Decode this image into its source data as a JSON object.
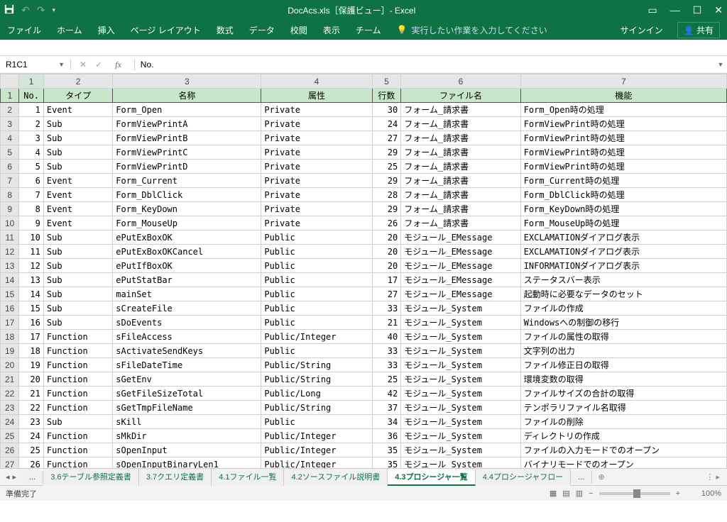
{
  "title": "DocAcs.xls［保護ビュー］- Excel",
  "qat": {
    "undo": "↶",
    "redo": "↷",
    "dd": "▾"
  },
  "ribbon": {
    "tabs": [
      "ファイル",
      "ホーム",
      "挿入",
      "ページ レイアウト",
      "数式",
      "データ",
      "校閲",
      "表示",
      "チーム"
    ],
    "tell_placeholder": "実行したい作業を入力してください",
    "signin": "サインイン",
    "share": "共有"
  },
  "namebox": "R1C1",
  "fx": "No.",
  "col_heads": [
    "",
    "1",
    "2",
    "3",
    "4",
    "5",
    "6",
    "7"
  ],
  "header_row": [
    "No.",
    "タイプ",
    "名称",
    "属性",
    "行数",
    "ファイル名",
    "機能"
  ],
  "rows": [
    {
      "n": "1",
      "no": "1",
      "type": "Event",
      "name": "Form_Open",
      "attr": "Private",
      "lines": "30",
      "file": "フォーム_請求書",
      "func": "Form_Open時の処理"
    },
    {
      "n": "2",
      "no": "2",
      "type": "Sub",
      "name": "FormViewPrintA",
      "attr": "Private",
      "lines": "24",
      "file": "フォーム_請求書",
      "func": "FormViewPrint時の処理"
    },
    {
      "n": "3",
      "no": "3",
      "type": "Sub",
      "name": "FormViewPrintB",
      "attr": "Private",
      "lines": "27",
      "file": "フォーム_請求書",
      "func": "FormViewPrint時の処理"
    },
    {
      "n": "4",
      "no": "4",
      "type": "Sub",
      "name": "FormViewPrintC",
      "attr": "Private",
      "lines": "29",
      "file": "フォーム_請求書",
      "func": "FormViewPrint時の処理"
    },
    {
      "n": "5",
      "no": "5",
      "type": "Sub",
      "name": "FormViewPrintD",
      "attr": "Private",
      "lines": "25",
      "file": "フォーム_請求書",
      "func": "FormViewPrint時の処理"
    },
    {
      "n": "6",
      "no": "6",
      "type": "Event",
      "name": "Form_Current",
      "attr": "Private",
      "lines": "29",
      "file": "フォーム_請求書",
      "func": "Form_Current時の処理"
    },
    {
      "n": "7",
      "no": "7",
      "type": "Event",
      "name": "Form_DblClick",
      "attr": "Private",
      "lines": "28",
      "file": "フォーム_請求書",
      "func": "Form_DblClick時の処理"
    },
    {
      "n": "8",
      "no": "8",
      "type": "Event",
      "name": "Form_KeyDown",
      "attr": "Private",
      "lines": "29",
      "file": "フォーム_請求書",
      "func": "Form_KeyDown時の処理"
    },
    {
      "n": "9",
      "no": "9",
      "type": "Event",
      "name": "Form_MouseUp",
      "attr": "Private",
      "lines": "26",
      "file": "フォーム_請求書",
      "func": "Form_MouseUp時の処理"
    },
    {
      "n": "10",
      "no": "10",
      "type": "Sub",
      "name": "ePutExBoxOK",
      "attr": "Public",
      "lines": "20",
      "file": "モジュール_EMessage",
      "func": "EXCLAMATIONダイアログ表示"
    },
    {
      "n": "11",
      "no": "11",
      "type": "Sub",
      "name": "ePutExBoxOKCancel",
      "attr": "Public",
      "lines": "20",
      "file": "モジュール_EMessage",
      "func": "EXCLAMATIONダイアログ表示"
    },
    {
      "n": "12",
      "no": "12",
      "type": "Sub",
      "name": "ePutIfBoxOK",
      "attr": "Public",
      "lines": "20",
      "file": "モジュール_EMessage",
      "func": "INFORMATIONダイアログ表示"
    },
    {
      "n": "13",
      "no": "13",
      "type": "Sub",
      "name": "ePutStatBar",
      "attr": "Public",
      "lines": "17",
      "file": "モジュール_EMessage",
      "func": "ステータスバー表示"
    },
    {
      "n": "14",
      "no": "14",
      "type": "Sub",
      "name": "mainSet",
      "attr": "Public",
      "lines": "27",
      "file": "モジュール_EMessage",
      "func": "起動時に必要なデータのセット"
    },
    {
      "n": "15",
      "no": "15",
      "type": "Sub",
      "name": "sCreateFile",
      "attr": "Public",
      "lines": "33",
      "file": "モジュール_System",
      "func": "ファイルの作成"
    },
    {
      "n": "16",
      "no": "16",
      "type": "Sub",
      "name": "sDoEvents",
      "attr": "Public",
      "lines": "21",
      "file": "モジュール_System",
      "func": "Windowsへの制御の移行"
    },
    {
      "n": "17",
      "no": "17",
      "type": "Function",
      "name": "sFileAccess",
      "attr": "Public/Integer",
      "lines": "40",
      "file": "モジュール_System",
      "func": "ファイルの属性の取得"
    },
    {
      "n": "18",
      "no": "18",
      "type": "Function",
      "name": "sActivateSendKeys",
      "attr": "Public",
      "lines": "33",
      "file": "モジュール_System",
      "func": "文字列の出力"
    },
    {
      "n": "19",
      "no": "19",
      "type": "Function",
      "name": "sFileDateTime",
      "attr": "Public/String",
      "lines": "33",
      "file": "モジュール_System",
      "func": "ファイル修正日の取得"
    },
    {
      "n": "20",
      "no": "20",
      "type": "Function",
      "name": "sGetEnv",
      "attr": "Public/String",
      "lines": "25",
      "file": "モジュール_System",
      "func": "環境変数の取得"
    },
    {
      "n": "21",
      "no": "21",
      "type": "Function",
      "name": "sGetFileSizeTotal",
      "attr": "Public/Long",
      "lines": "42",
      "file": "モジュール_System",
      "func": "ファイルサイズの合計の取得"
    },
    {
      "n": "22",
      "no": "22",
      "type": "Function",
      "name": "sGetTmpFileName",
      "attr": "Public/String",
      "lines": "37",
      "file": "モジュール_System",
      "func": "テンポラリファイル名取得"
    },
    {
      "n": "23",
      "no": "23",
      "type": "Sub",
      "name": "sKill",
      "attr": "Public",
      "lines": "34",
      "file": "モジュール_System",
      "func": "ファイルの削除"
    },
    {
      "n": "24",
      "no": "24",
      "type": "Function",
      "name": "sMkDir",
      "attr": "Public/Integer",
      "lines": "36",
      "file": "モジュール_System",
      "func": "ディレクトリの作成"
    },
    {
      "n": "25",
      "no": "25",
      "type": "Function",
      "name": "sOpenInput",
      "attr": "Public/Integer",
      "lines": "35",
      "file": "モジュール_System",
      "func": "ファイルの入力モードでのオープン"
    },
    {
      "n": "26",
      "no": "26",
      "type": "Function",
      "name": "sOpenInputBinaryLen1",
      "attr": "Public/Integer",
      "lines": "35",
      "file": "モジュール_System",
      "func": "バイナリモードでのオープン"
    }
  ],
  "sheets": {
    "more_left": "...",
    "items": [
      "3.6テーブル参照定義書",
      "3.7クエリ定義書",
      "4.1ファイル一覧",
      "4.2ソースファイル説明書",
      "4.3プロシージャ一覧",
      "4.4プロシージャフロー"
    ],
    "active_index": 4,
    "more_right": "..."
  },
  "status": {
    "ready": "準備完了",
    "zoom": "100%"
  }
}
